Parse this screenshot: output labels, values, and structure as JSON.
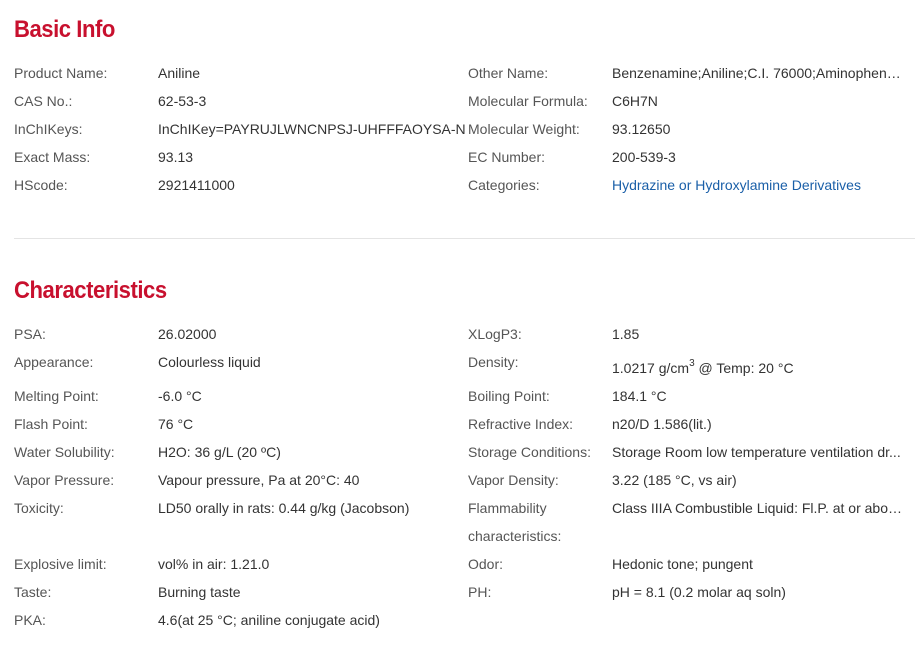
{
  "basic_info": {
    "title": "Basic Info",
    "left": [
      {
        "label": "Product Name:",
        "value": "Aniline"
      },
      {
        "label": "CAS No.:",
        "value": "62-53-3"
      },
      {
        "label": "InChIKeys:",
        "value": "InChIKey=PAYRUJLWNCNPSJ-UHFFFAOYSA-N"
      },
      {
        "label": "Exact Mass:",
        "value": "93.13"
      },
      {
        "label": "HScode:",
        "value": "2921411000"
      }
    ],
    "right": [
      {
        "label": "Other Name:",
        "value": "Benzenamine;Aniline;C.I. 76000;Aminophen;B..."
      },
      {
        "label": "Molecular Formula:",
        "value": "C6H7N"
      },
      {
        "label": "Molecular Weight:",
        "value": "93.12650"
      },
      {
        "label": "EC Number:",
        "value": "200-539-3"
      },
      {
        "label": "Categories:",
        "value": "Hydrazine or Hydroxylamine Derivatives"
      }
    ]
  },
  "characteristics": {
    "title": "Characteristics",
    "left": [
      {
        "label": "PSA:",
        "value": "26.02000"
      },
      {
        "label": "Appearance:",
        "value": "Colourless liquid"
      },
      {
        "label": "Melting Point:",
        "value": "-6.0 °C"
      },
      {
        "label": "Flash Point:",
        "value": "76 °C"
      },
      {
        "label": "Water Solubility:",
        "value": "H2O: 36 g/L (20 ºC)"
      },
      {
        "label": "Vapor Pressure:",
        "value": "Vapour pressure, Pa at 20°C: 40"
      },
      {
        "label": "Toxicity:",
        "value": "LD50 orally in rats: 0.44 g/kg (Jacobson)"
      },
      {
        "label": "Explosive limit:",
        "value": "vol% in air: 1.21.0"
      },
      {
        "label": "Taste:",
        "value": "Burning taste"
      },
      {
        "label": "PKA:",
        "value": "4.6(at 25 °C; aniline conjugate acid)"
      }
    ],
    "right": [
      {
        "label": "XLogP3:",
        "value": "1.85"
      },
      {
        "label": "Density:",
        "value_prefix": "1.0217 g/cm",
        "value_sup": "3",
        "value_suffix": " @ Temp: 20 °C"
      },
      {
        "label": "Boiling Point:",
        "value": "184.1 °C"
      },
      {
        "label": "Refractive Index:",
        "value": "n20/D 1.586(lit.)"
      },
      {
        "label": "Storage Conditions:",
        "value": "Storage Room low temperature ventilation dr..."
      },
      {
        "label": "Vapor Density:",
        "value": "3.22 (185 °C, vs air)"
      },
      {
        "label": "Flammability characteristics:",
        "label_line1": "Flammability",
        "label_line2": "characteristics:",
        "value": "Class IIIA Combustible Liquid: Fl.P. at or abov..."
      },
      {
        "label": "Odor:",
        "value": "Hedonic tone; pungent"
      },
      {
        "label": "PH:",
        "value": "pH = 8.1 (0.2 molar aq soln)"
      }
    ]
  }
}
